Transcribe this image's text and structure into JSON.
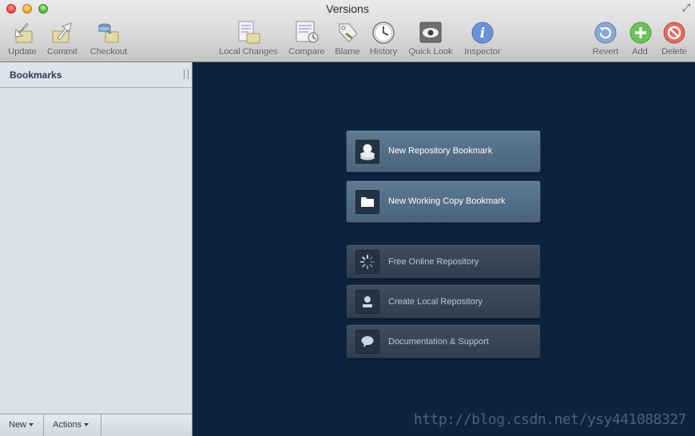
{
  "window": {
    "title": "Versions"
  },
  "toolbar": {
    "left": [
      {
        "label": "Update"
      },
      {
        "label": "Commit"
      },
      {
        "label": "Checkout"
      }
    ],
    "center": [
      {
        "label": "Local Changes"
      },
      {
        "label": "Compare"
      },
      {
        "label": "Blame"
      },
      {
        "label": "History"
      },
      {
        "label": "Quick Look"
      },
      {
        "label": "Inspector"
      }
    ],
    "right": [
      {
        "label": "Revert"
      },
      {
        "label": "Add"
      },
      {
        "label": "Delete"
      }
    ]
  },
  "sidebar": {
    "title": "Bookmarks",
    "footer": {
      "new_label": "New",
      "actions_label": "Actions"
    }
  },
  "main": {
    "primary_actions": [
      {
        "label": "New Repository Bookmark",
        "icon": "repository-icon"
      },
      {
        "label": "New Working Copy Bookmark",
        "icon": "folder-icon"
      }
    ],
    "secondary_actions": [
      {
        "label": "Free Online Repository",
        "icon": "spinner-icon"
      },
      {
        "label": "Create Local Repository",
        "icon": "database-icon"
      },
      {
        "label": "Documentation & Support",
        "icon": "speech-bubble-icon"
      }
    ]
  },
  "watermark": "http://blog.csdn.net/ysy441088327",
  "colors": {
    "main_bg": "#0c2440",
    "sidebar_bg": "#d7e1ea",
    "primary_button": "#55708a"
  }
}
